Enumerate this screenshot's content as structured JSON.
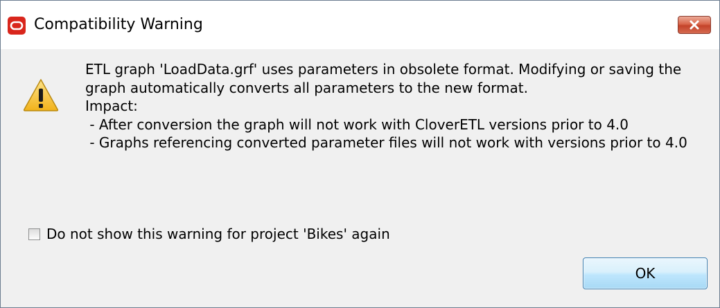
{
  "window": {
    "title": "Compatibility Warning",
    "app_icon": "oracle-logo-icon",
    "close_icon": "close-icon"
  },
  "message": {
    "icon": "warning-icon",
    "lines": [
      "ETL graph 'LoadData.grf' uses parameters in obsolete format. Modifying or saving the graph automatically converts all parameters to the new format.",
      "Impact:",
      " - After conversion the graph will not work with CloverETL versions prior to 4.0",
      " - Graphs referencing converted parameter files will not work with versions prior to 4.0"
    ]
  },
  "checkbox": {
    "label": "Do not show this warning for project 'Bikes' again",
    "checked": false
  },
  "buttons": {
    "ok_label": "OK"
  },
  "colors": {
    "close_button": "#c9452d",
    "app_icon": "#d9261c",
    "warning_fill": "#f6c532",
    "ok_button_border": "#3c7fb1"
  }
}
